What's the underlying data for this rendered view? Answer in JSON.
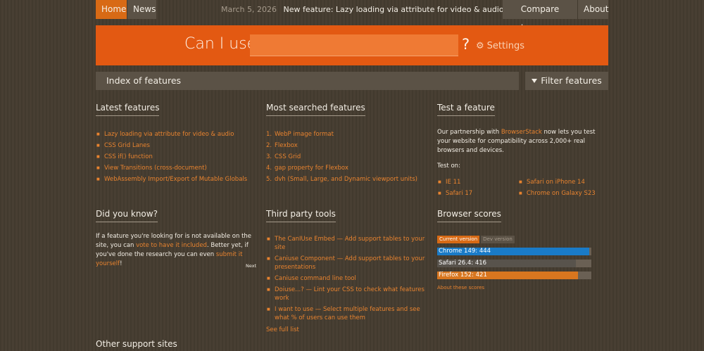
{
  "nav": {
    "home": "Home",
    "news": "News",
    "compare": "Compare browsers",
    "about": "About",
    "news_date": "March 5, 2026",
    "news_text": "New feature: Lazy loading via attribute for video & audio"
  },
  "banner": {
    "title": "Can I use",
    "search_value": "",
    "question": "?",
    "settings": "Settings"
  },
  "indexbar": {
    "title": "Index of features",
    "filter": "Filter features"
  },
  "latest": {
    "title": "Latest features",
    "items": [
      "Lazy loading via attribute for video & audio",
      "CSS Grid Lanes",
      "CSS if() function",
      "View Transitions (cross-document)",
      "WebAssembly Import/Export of Mutable Globals"
    ]
  },
  "most_searched": {
    "title": "Most searched features",
    "items": [
      {
        "num": "1.",
        "label": "WebP image format"
      },
      {
        "num": "2.",
        "label": "Flexbox"
      },
      {
        "num": "3.",
        "label": "CSS Grid"
      },
      {
        "num": "4.",
        "label": "gap property for Flexbox"
      },
      {
        "num": "5.",
        "label": "dvh (Small, Large, and Dynamic viewport units)"
      }
    ]
  },
  "test": {
    "title": "Test a feature",
    "text_before": "Our partnership with ",
    "link": "BrowserStack",
    "text_after": " now lets you test your website for compatibility across 2,000+ real browsers and devices.",
    "test_on": "Test on:",
    "items": [
      "IE 11",
      "Safari on iPhone 14",
      "Safari 17",
      "Chrome on Galaxy S23"
    ]
  },
  "did_you_know": {
    "title": "Did you know?",
    "t1": "If a feature you're looking for is not available on the site, you can ",
    "l1": "vote to have it included",
    "t2": ". Better yet, if you've done the research you can even ",
    "l2": "submit it yourself",
    "t3": "!",
    "next": "Next"
  },
  "third_party": {
    "title": "Third party tools",
    "items": [
      "The CanIUse Embed — Add support tables to your site",
      "Caniuse Component — Add support tables to your presentations",
      "Caniuse command line tool",
      "Doiuse...? — Lint your CSS to check what features work",
      "I want to use — Select multiple features and see what % of users can use them"
    ],
    "see_full": "See full list"
  },
  "scores": {
    "title": "Browser scores",
    "current": "Current version",
    "dev": "Dev version",
    "bars": [
      {
        "label": "Chrome 149: 444",
        "fraction": 0.985,
        "color": "#1a7bc7"
      },
      {
        "label": "Safari 26.4: 416",
        "fraction": 0.899,
        "color": "#58534c"
      },
      {
        "label": "Firefox 152: 421",
        "fraction": 0.914,
        "color": "#d8761f"
      }
    ],
    "about": "About these scores"
  },
  "other": {
    "title": "Other support sites"
  }
}
